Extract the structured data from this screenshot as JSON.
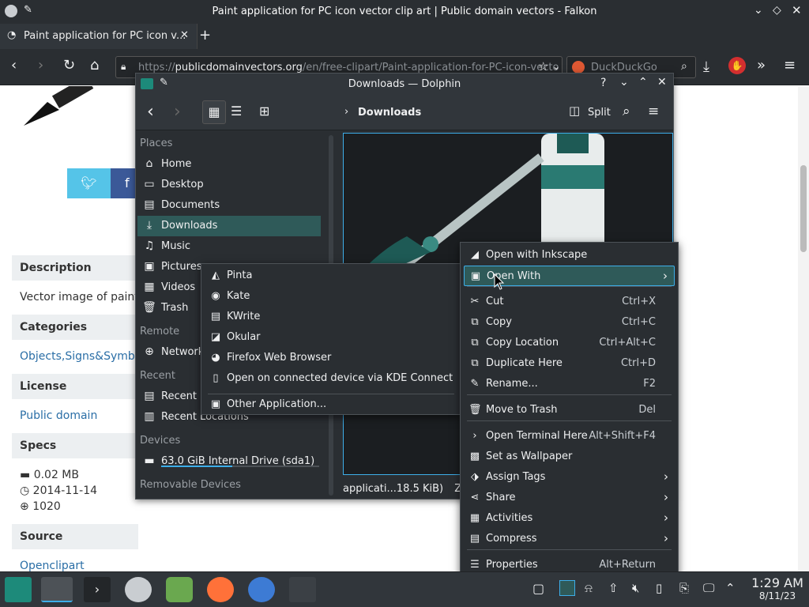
{
  "browser": {
    "window_title": "Paint application for PC icon vector clip art | Public domain vectors - Falkon",
    "tab_label": "Paint application for PC icon v...",
    "url_prefix": "https://",
    "url_host": "publicdomainvectors.org",
    "url_path": "/en/free-clipart/Paint-application-for-PC-icon-vecto",
    "search_placeholder": "DuckDuckGo"
  },
  "webpage": {
    "description_header": "Description",
    "description_text": "Vector image of paint a",
    "categories_header": "Categories",
    "categories_link": "Objects,Signs&Symbol",
    "license_header": "License",
    "license_link": "Public domain",
    "specs_header": "Specs",
    "specs_size": "0.02 MB",
    "specs_date": "2014-11-14",
    "specs_downloads": "1020",
    "source_header": "Source",
    "source_link": "Openclipart"
  },
  "dolphin": {
    "title": "Downloads — Dolphin",
    "breadcrumb": "Downloads",
    "split_label": "Split",
    "places_header": "Places",
    "remote_header": "Remote",
    "recent_header": "Recent",
    "devices_header": "Devices",
    "removable_header": "Removable Devices",
    "places": [
      {
        "label": "Home",
        "icon": "home-icon"
      },
      {
        "label": "Desktop",
        "icon": "desktop-icon"
      },
      {
        "label": "Documents",
        "icon": "documents-icon"
      },
      {
        "label": "Downloads",
        "icon": "download-icon"
      },
      {
        "label": "Music",
        "icon": "music-icon"
      },
      {
        "label": "Pictures",
        "icon": "pictures-icon"
      },
      {
        "label": "Videos",
        "icon": "videos-icon"
      },
      {
        "label": "Trash",
        "icon": "trash-icon"
      }
    ],
    "remote": [
      {
        "label": "Network",
        "icon": "network-icon"
      }
    ],
    "recent": [
      {
        "label": "Recent F",
        "icon": "recent-files-icon"
      },
      {
        "label": "Recent Locations",
        "icon": "recent-locations-icon"
      }
    ],
    "devices": [
      {
        "label": "63.0 GiB Internal Drive (sda1)",
        "icon": "drive-icon"
      }
    ],
    "status_text": "applicati...18.5 KiB)",
    "status_zoom": "Zoo"
  },
  "context_menu": {
    "items": [
      {
        "label": "Open with Inkscape",
        "shortcut": "",
        "icon": "inkscape-icon"
      },
      {
        "label": "Open With",
        "shortcut": "",
        "icon": "open-with-icon",
        "submenu": true
      },
      {
        "label": "Cut",
        "shortcut": "Ctrl+X",
        "icon": "cut-icon"
      },
      {
        "label": "Copy",
        "shortcut": "Ctrl+C",
        "icon": "copy-icon"
      },
      {
        "label": "Copy Location",
        "shortcut": "Ctrl+Alt+C",
        "icon": "copy-location-icon"
      },
      {
        "label": "Duplicate Here",
        "shortcut": "Ctrl+D",
        "icon": "duplicate-icon"
      },
      {
        "label": "Rename...",
        "shortcut": "F2",
        "icon": "rename-icon"
      },
      {
        "label": "Move to Trash",
        "shortcut": "Del",
        "icon": "trash-icon"
      },
      {
        "label": "Open Terminal Here",
        "shortcut": "Alt+Shift+F4",
        "icon": "terminal-icon"
      },
      {
        "label": "Set as Wallpaper",
        "shortcut": "",
        "icon": "wallpaper-icon"
      },
      {
        "label": "Assign Tags",
        "shortcut": "",
        "icon": "tag-icon",
        "submenu": true
      },
      {
        "label": "Share",
        "shortcut": "",
        "icon": "share-icon",
        "submenu": true
      },
      {
        "label": "Activities",
        "shortcut": "",
        "icon": "activities-icon",
        "submenu": true
      },
      {
        "label": "Compress",
        "shortcut": "",
        "icon": "compress-icon",
        "submenu": true
      },
      {
        "label": "Properties",
        "shortcut": "Alt+Return",
        "icon": "properties-icon"
      }
    ]
  },
  "open_with_submenu": {
    "items": [
      {
        "label": "Pinta",
        "icon": "pinta-icon"
      },
      {
        "label": "Kate",
        "icon": "kate-icon"
      },
      {
        "label": "KWrite",
        "icon": "kwrite-icon"
      },
      {
        "label": "Okular",
        "icon": "okular-icon"
      },
      {
        "label": "Firefox Web Browser",
        "icon": "firefox-icon"
      },
      {
        "label": "Open on connected device via KDE Connect",
        "icon": "kdeconnect-icon"
      },
      {
        "label": "Other Application...",
        "icon": "other-application-icon"
      }
    ]
  },
  "taskbar": {
    "time": "1:29 AM",
    "date": "8/11/23"
  },
  "colors": {
    "dark_bg": "#2a2e32",
    "highlight": "#2f5a59",
    "accent": "#3daee9"
  }
}
